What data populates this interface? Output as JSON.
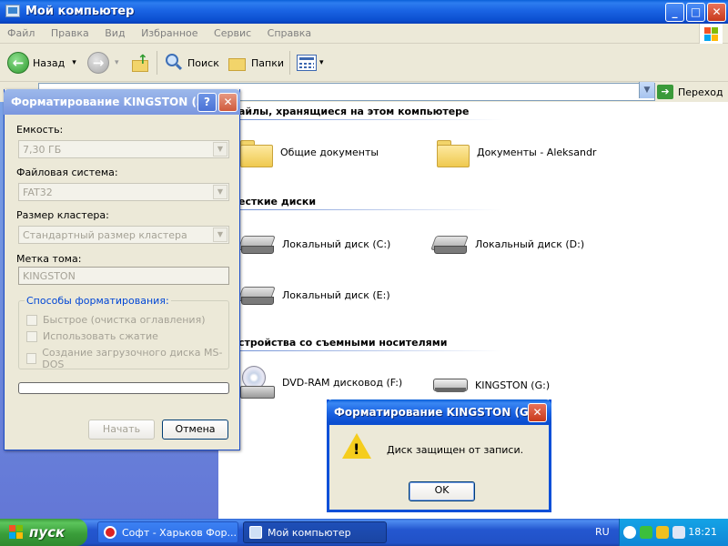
{
  "main_window": {
    "title": "Мой компьютер",
    "controls": {
      "minimize": "_",
      "maximize": "□",
      "close": "✕"
    }
  },
  "menu": [
    "Файл",
    "Правка",
    "Вид",
    "Избранное",
    "Сервис",
    "Справка"
  ],
  "toolbar": {
    "back": "Назад",
    "search": "Поиск",
    "folders": "Папки",
    "back_dropdown": "▾",
    "views_dropdown": "▾"
  },
  "address": {
    "value": "",
    "go": "Переход"
  },
  "groups": {
    "files": "айлы, хранящиеся на этом компьютере",
    "hard_drives": "есткие диски",
    "removable": "стройства со съемными носителями"
  },
  "items": {
    "shared_docs": "Общие документы",
    "user_docs": "Документы - Aleksandr",
    "drive_c": "Локальный диск (C:)",
    "drive_d": "Локальный диск (D:)",
    "drive_e": "Локальный диск (E:)",
    "dvd_f": "DVD-RAM дисковод (F:)",
    "kingston_g": "KINGSTON (G:)"
  },
  "format_dialog": {
    "title": "Форматирование KINGSTON (…",
    "help": "?",
    "close": "✕",
    "capacity_label": "Емкость:",
    "capacity_value": "7,30 ГБ",
    "fs_label": "Файловая система:",
    "fs_value": "FAT32",
    "cluster_label": "Размер кластера:",
    "cluster_value": "Стандартный размер кластера",
    "volume_label": "Метка тома:",
    "volume_value": "KINGSTON",
    "options_title": "Способы форматирования:",
    "opt_quick": "Быстрое (очистка оглавления)",
    "opt_compress": "Использовать сжатие",
    "opt_msdos": "Создание загрузочного диска MS-DOS",
    "start": "Начать",
    "cancel": "Отмена",
    "combo_arrow": "▼"
  },
  "alert_dialog": {
    "title": "Форматирование KINGSTON (G:)",
    "close": "✕",
    "icon_mark": "!",
    "message": "Диск защищен от записи.",
    "ok": "OK"
  },
  "taskbar": {
    "start": "пуск",
    "tasks": [
      {
        "label": "Софт - Харьков Фор..."
      },
      {
        "label": "Мой компьютер"
      }
    ],
    "language": "RU",
    "clock": "18:21"
  },
  "colors": {
    "xp_blue": "#0a5fd8",
    "start_green": "#3a9e3a",
    "warning_yellow": "#f5cd1e",
    "groupbox_title": "#0046d5"
  }
}
